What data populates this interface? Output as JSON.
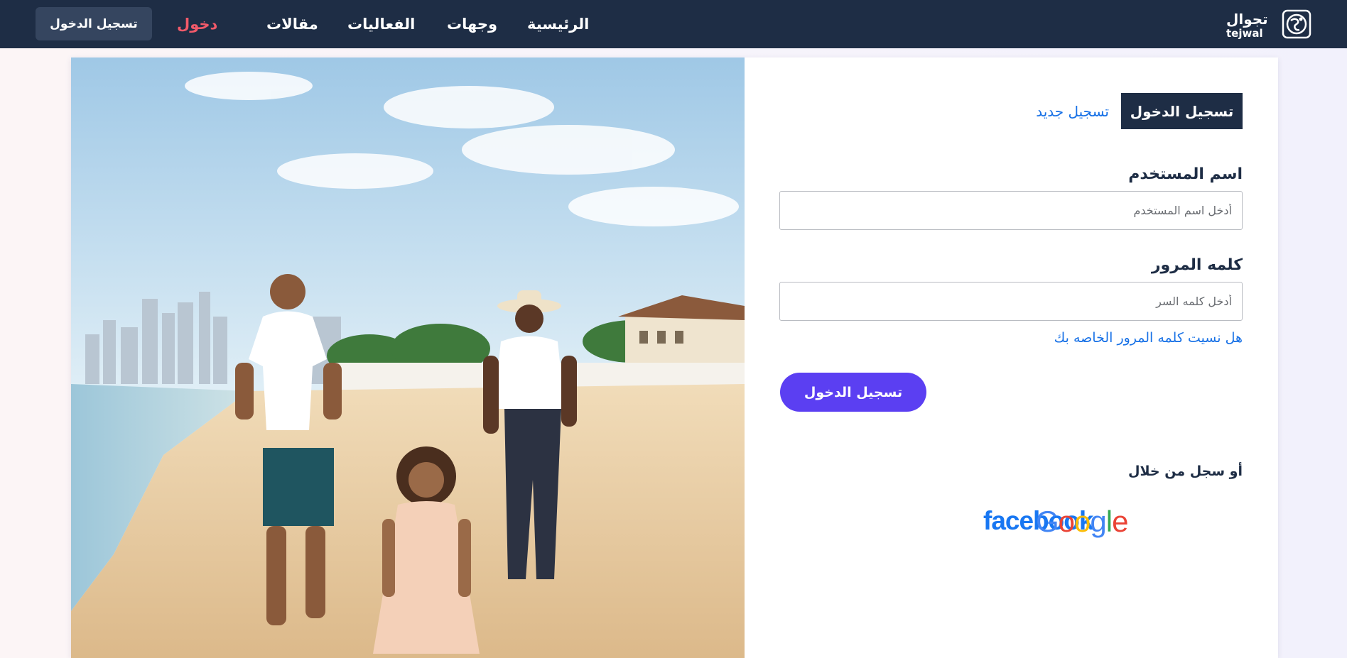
{
  "nav": {
    "login_button": "تسجيل الدخول",
    "links": [
      "الرئيسية",
      "وجهات",
      "الفعاليات",
      "مقالات"
    ],
    "active_link": "دخول",
    "logo_text_ar": "تجوال",
    "logo_text_en": "tejwal"
  },
  "form": {
    "tab_login": "تسجيل الدخول",
    "tab_register": "تسجيل جديد",
    "username_label": "اسم المستخدم",
    "username_placeholder": "أدخل اسم المستخدم",
    "username_value": "",
    "password_label": "كلمه المرور",
    "password_placeholder": "أدخل كلمه السر",
    "password_value": "",
    "forgot_password": "هل نسيت كلمه المرور الخاصه بك",
    "submit_label": "تسجيل الدخول",
    "or_signin_with": "أو سجل من خلال"
  },
  "social": {
    "facebook": "facebook",
    "google": "Google"
  },
  "colors": {
    "navbar_bg": "#1e2d45",
    "active_link": "#f25a6a",
    "link_blue": "#1670e6",
    "submit_purple": "#5b3ff2",
    "facebook_blue": "#1877f2"
  },
  "icons": {
    "logo": "globe-logo-icon"
  }
}
